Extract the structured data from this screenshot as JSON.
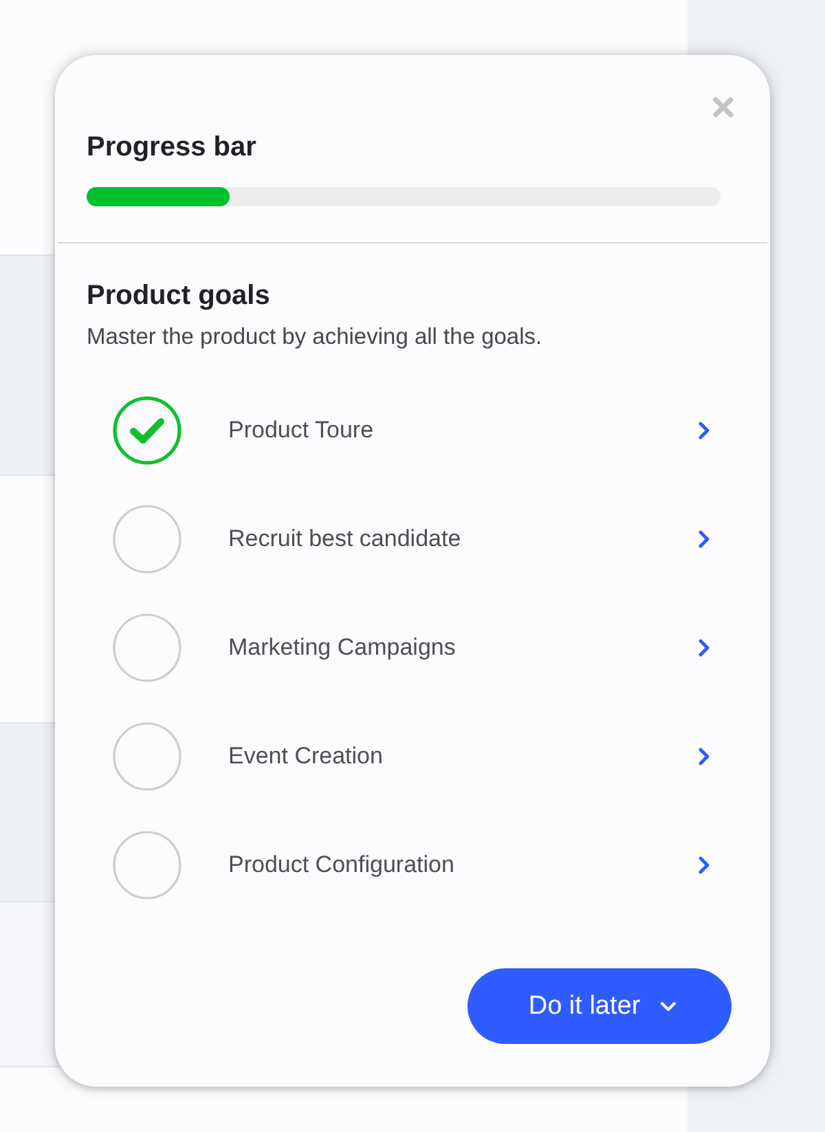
{
  "progress": {
    "title": "Progress bar",
    "level": 0.225
  },
  "goals": {
    "title": "Product goals",
    "subtitle": "Master the product by achieving all the goals.",
    "items": [
      {
        "label": "Product Toure",
        "checked": true
      },
      {
        "label": "Recruit best candidate",
        "checked": false
      },
      {
        "label": "Marketing Campaigns",
        "checked": false
      },
      {
        "label": "Event Creation",
        "checked": false
      },
      {
        "label": "Product Configuration",
        "checked": false
      }
    ]
  },
  "action_button": {
    "label": "Do it later"
  }
}
